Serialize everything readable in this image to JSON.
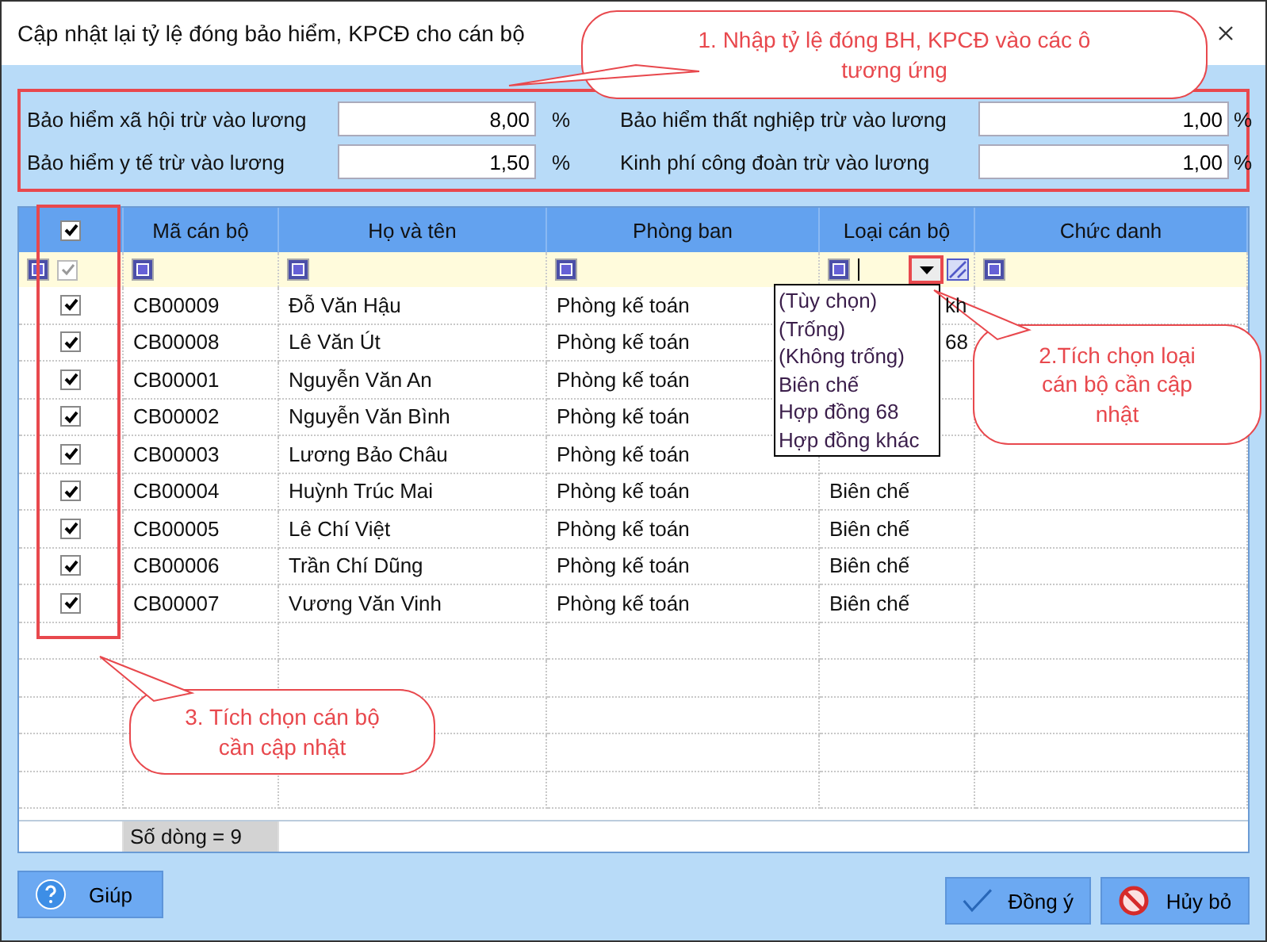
{
  "window": {
    "title": "Cập nhật lại tỷ lệ đóng bảo hiểm, KPCĐ cho cán bộ"
  },
  "rates": [
    {
      "label": "Bảo hiểm xã hội trừ vào lương",
      "value": "8,00",
      "unit": "%"
    },
    {
      "label": "Bảo hiểm thất nghiệp trừ vào lương",
      "value": "1,00",
      "unit": "%"
    },
    {
      "label": "Bảo hiểm y tế trừ vào lương",
      "value": "1,50",
      "unit": "%"
    },
    {
      "label": "Kinh phí công đoàn trừ vào lương",
      "value": "1,00",
      "unit": "%"
    }
  ],
  "table": {
    "header_checkbox": {
      "checked": true
    },
    "filter_checkbox": {
      "checked": true
    },
    "columns": [
      "Mã cán bộ",
      "Họ và tên",
      "Phòng ban",
      "Loại cán bộ",
      "Chức danh"
    ],
    "rows": [
      {
        "checked": true,
        "code": "CB00009",
        "name": "Đỗ Văn Hậu",
        "dept": "Phòng kế toán",
        "type": "kh"
      },
      {
        "checked": true,
        "code": "CB00008",
        "name": "Lê Văn Út",
        "dept": "Phòng kế toán",
        "type": "68"
      },
      {
        "checked": true,
        "code": "CB00001",
        "name": "Nguyễn Văn An",
        "dept": "Phòng kế toán"
      },
      {
        "checked": true,
        "code": "CB00002",
        "name": "Nguyễn Văn Bình",
        "dept": "Phòng kế toán"
      },
      {
        "checked": true,
        "code": "CB00003",
        "name": "Lương Bảo Châu",
        "dept": "Phòng kế toán"
      },
      {
        "checked": true,
        "code": "CB00004",
        "name": "Huỳnh Trúc Mai",
        "dept": "Phòng kế toán",
        "type": "Biên chế"
      },
      {
        "checked": true,
        "code": "CB00005",
        "name": "Lê Chí Việt",
        "dept": "Phòng kế toán",
        "type": "Biên chế"
      },
      {
        "checked": true,
        "code": "CB00006",
        "name": "Trần Chí Dũng",
        "dept": "Phòng kế toán",
        "type": "Biên chế"
      },
      {
        "checked": true,
        "code": "CB00007",
        "name": "Vương Văn Vinh",
        "dept": "Phòng kế toán",
        "type": "Biên chế"
      }
    ],
    "footer": "Số dòng = 9"
  },
  "dropdown": {
    "options": [
      "(Tùy chọn)",
      "(Trống)",
      "(Không trống)",
      "Biên chế",
      "Hợp đồng 68",
      "Hợp đồng khác"
    ]
  },
  "callouts": [
    "1. Nhập tỷ lệ đóng BH, KPCĐ vào các ô tương ứng",
    "2.Tích chọn loại cán bộ cần cập nhật",
    "3. Tích chọn cán bộ cần cập nhật"
  ],
  "buttons": [
    {
      "kind": "help",
      "label": "Giúp"
    },
    {
      "kind": "ok",
      "label": "Đồng ý"
    },
    {
      "kind": "cancel",
      "label": "Hủy bỏ"
    }
  ]
}
